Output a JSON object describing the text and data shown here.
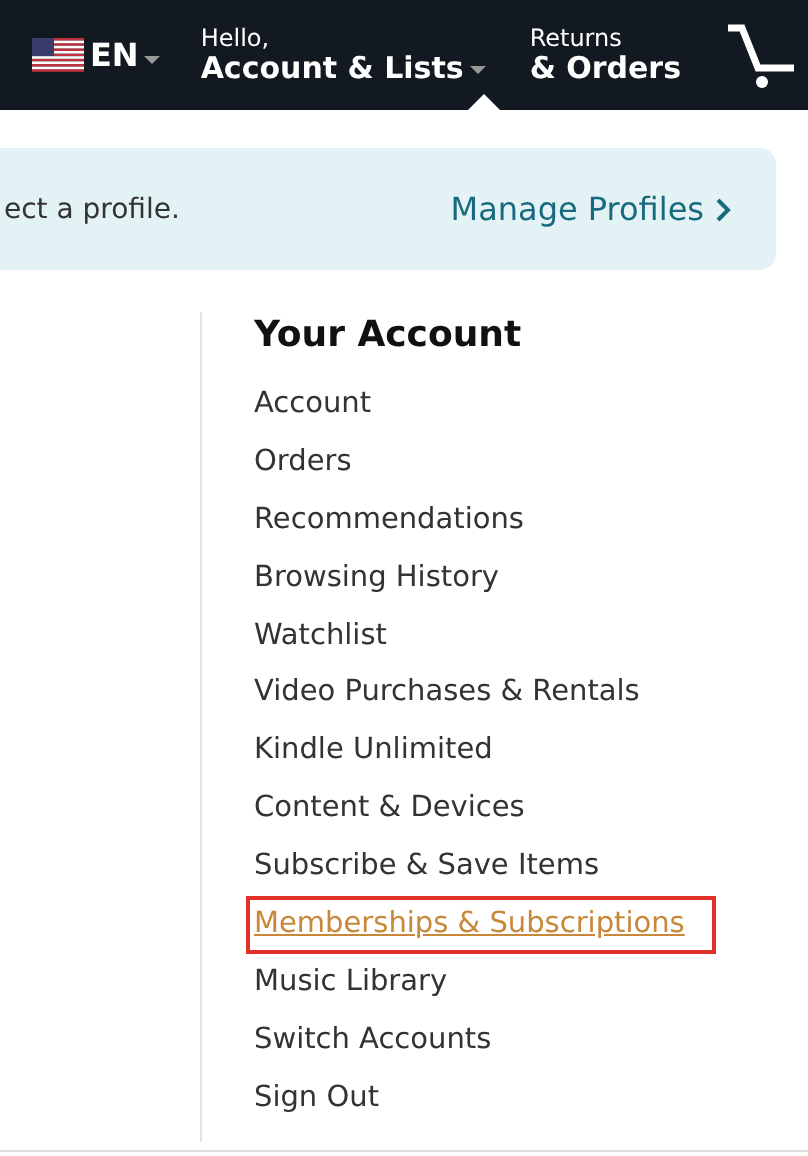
{
  "nav": {
    "language": "EN",
    "greeting": "Hello,",
    "account": "Account & Lists",
    "returns": "Returns",
    "orders": "& Orders"
  },
  "profile_banner": {
    "message": "ect a profile.",
    "link": "Manage Profiles"
  },
  "menu": {
    "title": "Your Account",
    "items": [
      {
        "label": "Account",
        "selected": false
      },
      {
        "label": "Orders",
        "selected": false
      },
      {
        "label": "Recommendations",
        "selected": false
      },
      {
        "label": "Browsing History",
        "selected": false
      },
      {
        "label": "Watchlist",
        "selected": false
      },
      {
        "label": "Video Purchases & Rentals",
        "selected": false
      },
      {
        "label": "Kindle Unlimited",
        "selected": false
      },
      {
        "label": "Content & Devices",
        "selected": false
      },
      {
        "label": "Subscribe & Save Items",
        "selected": false
      },
      {
        "label": "Memberships & Subscriptions",
        "selected": true
      },
      {
        "label": "Music Library",
        "selected": false
      },
      {
        "label": "Switch Accounts",
        "selected": false
      },
      {
        "label": "Sign Out",
        "selected": false
      }
    ]
  }
}
